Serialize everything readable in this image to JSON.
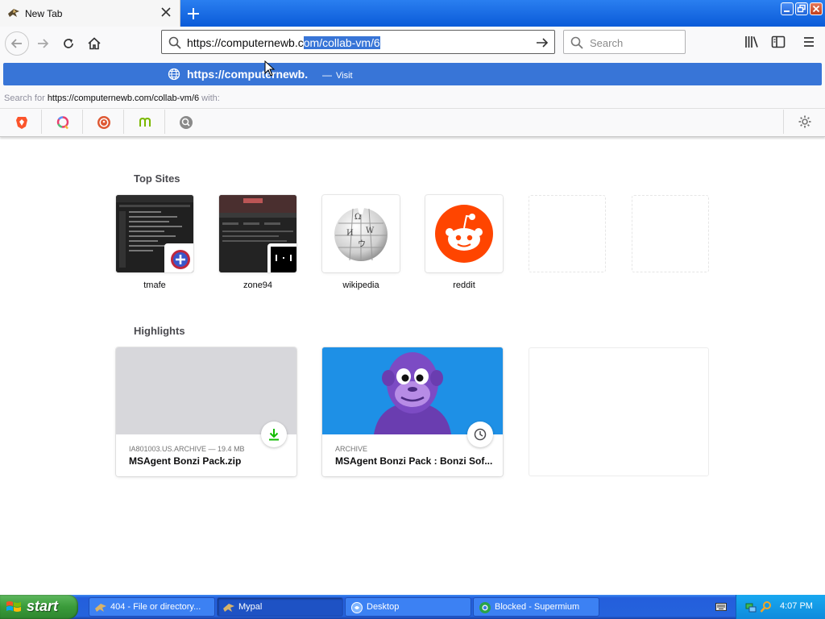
{
  "browser": {
    "tab": {
      "title": "New Tab"
    },
    "url": {
      "typed_prefix": "https://computernewb.c",
      "selected_suffix": "om/collab-vm/6"
    },
    "search": {
      "placeholder": "Search"
    }
  },
  "dropdown": {
    "suggestion": {
      "url": "https://computernewb.",
      "separator": "—",
      "action": "Visit"
    },
    "search_for": {
      "prefix": "Search for ",
      "query": "https://computernewb.com/collab-vm/6",
      "suffix": " with:"
    },
    "engines": [
      "brave-icon",
      "qwant-icon",
      "duckduckgo-icon",
      "mojeek-icon",
      "search-engine-icon"
    ]
  },
  "top_sites": {
    "title": "Top Sites",
    "items": [
      {
        "label": "tmafe"
      },
      {
        "label": "zone94"
      },
      {
        "label": "wikipedia"
      },
      {
        "label": "reddit"
      }
    ]
  },
  "highlights": {
    "title": "Highlights",
    "items": [
      {
        "context": "IA801003.US.ARCHIVE — 19.4 MB",
        "title": "MSAgent Bonzi Pack.zip",
        "type": "download-icon"
      },
      {
        "context": "ARCHIVE",
        "title": "MSAgent Bonzi Pack : Bonzi Sof...",
        "type": "clock-icon"
      }
    ]
  },
  "taskbar": {
    "start": "start",
    "items": [
      {
        "label": "404 - File or directory..."
      },
      {
        "label": "Mypal"
      },
      {
        "label": "Desktop"
      },
      {
        "label": "Blocked - Supermium"
      }
    ],
    "clock": "4:07 PM"
  },
  "colors": {
    "accent": "#3875d7",
    "reddit": "#ff4500",
    "bonzi_bg": "#1e90e6",
    "taskbar": "#245edb"
  }
}
